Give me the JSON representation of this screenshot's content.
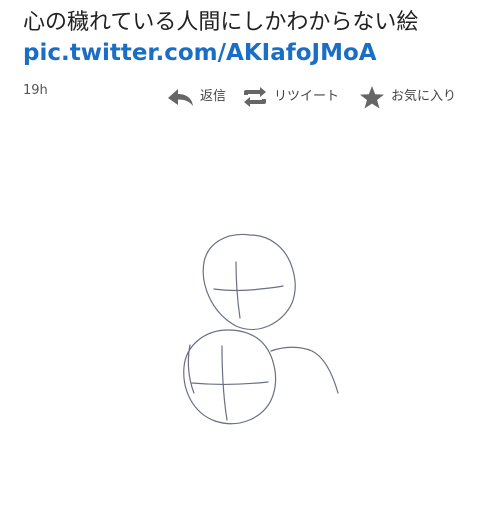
{
  "tweet": {
    "text": "心の穢れている人間にしかわからない絵",
    "link": "pic.twitter.com/AKIafoJMoA",
    "timestamp": "19h"
  },
  "actions": {
    "reply_label": "返信",
    "retweet_label": "リツイート",
    "favorite_label": "お気に入り"
  },
  "colors": {
    "link": "#1a6fc4",
    "icon": "#666666",
    "sketch": "#6a6f86"
  }
}
